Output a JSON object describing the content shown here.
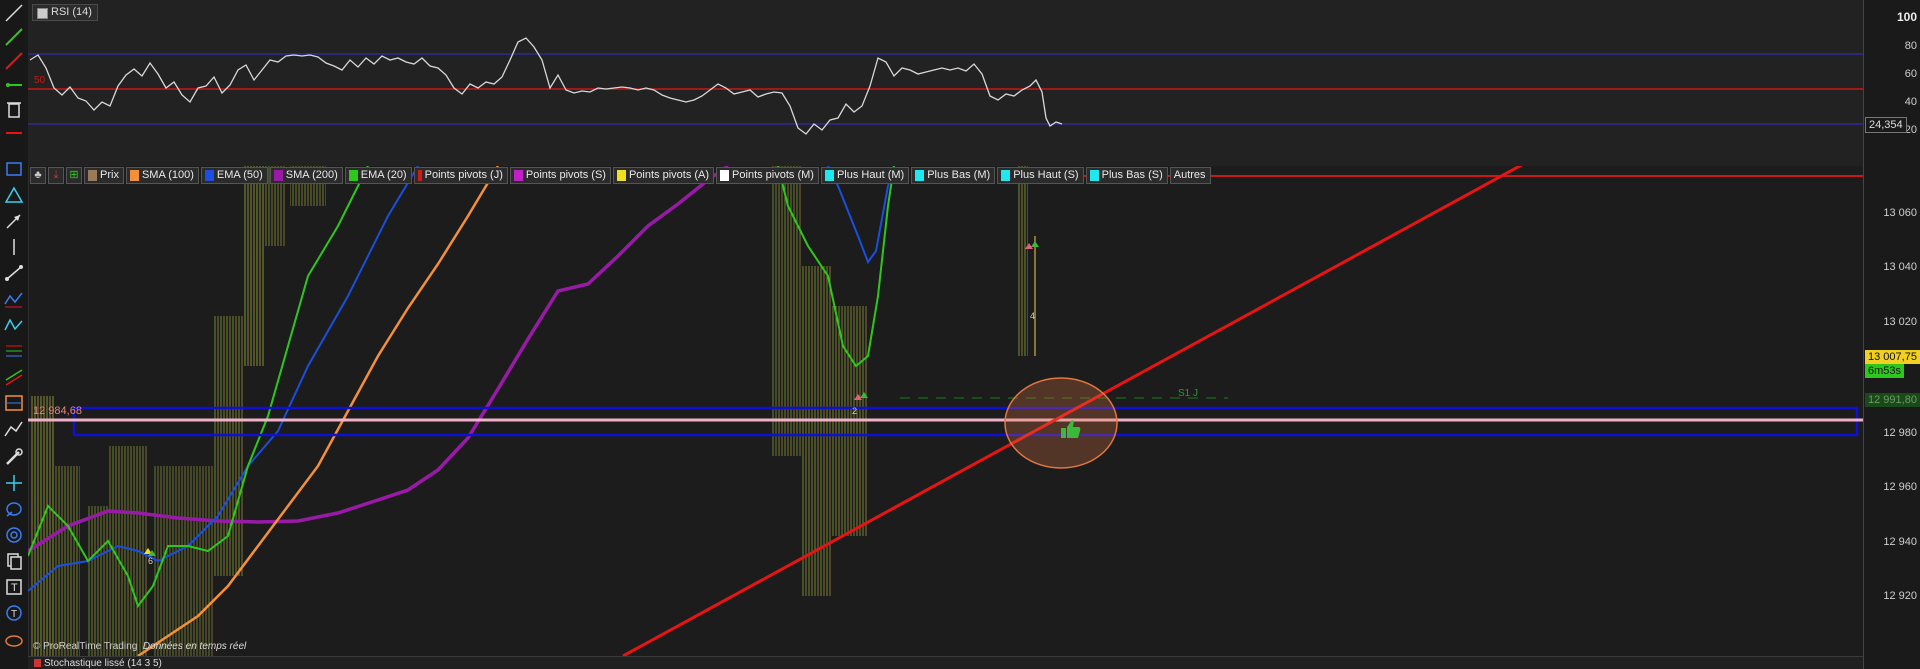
{
  "rsi": {
    "label": "RSI (14)",
    "level_label": "50",
    "value_badge": "24,354",
    "axis": [
      "100",
      "80",
      "60",
      "40",
      "20"
    ]
  },
  "legend": [
    {
      "label": "Prix",
      "color": "#9a7a5a"
    },
    {
      "label": "SMA (100)",
      "color": "#f5903a"
    },
    {
      "label": "EMA (50)",
      "color": "#1a4fe0"
    },
    {
      "label": "SMA (200)",
      "color": "#9a1aa8"
    },
    {
      "label": "EMA (20)",
      "color": "#2ec81c"
    },
    {
      "label": "Points pivots (J)",
      "color": "#d01a1a"
    },
    {
      "label": "Points pivots (S)",
      "color": "#c020c8"
    },
    {
      "label": "Points pivots (A)",
      "color": "#f0e020"
    },
    {
      "label": "Points pivots (M)",
      "color": "#ffffff"
    },
    {
      "label": "Plus Haut (M)",
      "color": "#20e8f0"
    },
    {
      "label": "Plus Bas (M)",
      "color": "#20e8f0"
    },
    {
      "label": "Plus Haut (S)",
      "color": "#20e8f0"
    },
    {
      "label": "Plus Bas (S)",
      "color": "#20e8f0"
    }
  ],
  "legend_more": "Autres",
  "price_axis": [
    "13 060",
    "13 040",
    "13 020",
    "12 980",
    "12 960",
    "12 940",
    "12 920"
  ],
  "badges": {
    "last_price": "13 007,75",
    "countdown": "6m53s",
    "pivot_value": "12 991,80"
  },
  "chart_labels": {
    "level_value": "12 984,68",
    "pivot_name": "S1 J",
    "marker_1": "2",
    "marker_2": "4",
    "marker_3": "6"
  },
  "footer": {
    "credit": "© ProRealTime Trading",
    "realtime": "Données en temps réel"
  },
  "stochastic": {
    "label": "Stochastique lissé (14 3 5)"
  },
  "colors": {
    "trendline": "#e81414",
    "zone_border": "#1010d0",
    "zone_line": "#f0b0c8",
    "highlight_circle": "#e07840",
    "thumb_icon": "#3db83d"
  }
}
